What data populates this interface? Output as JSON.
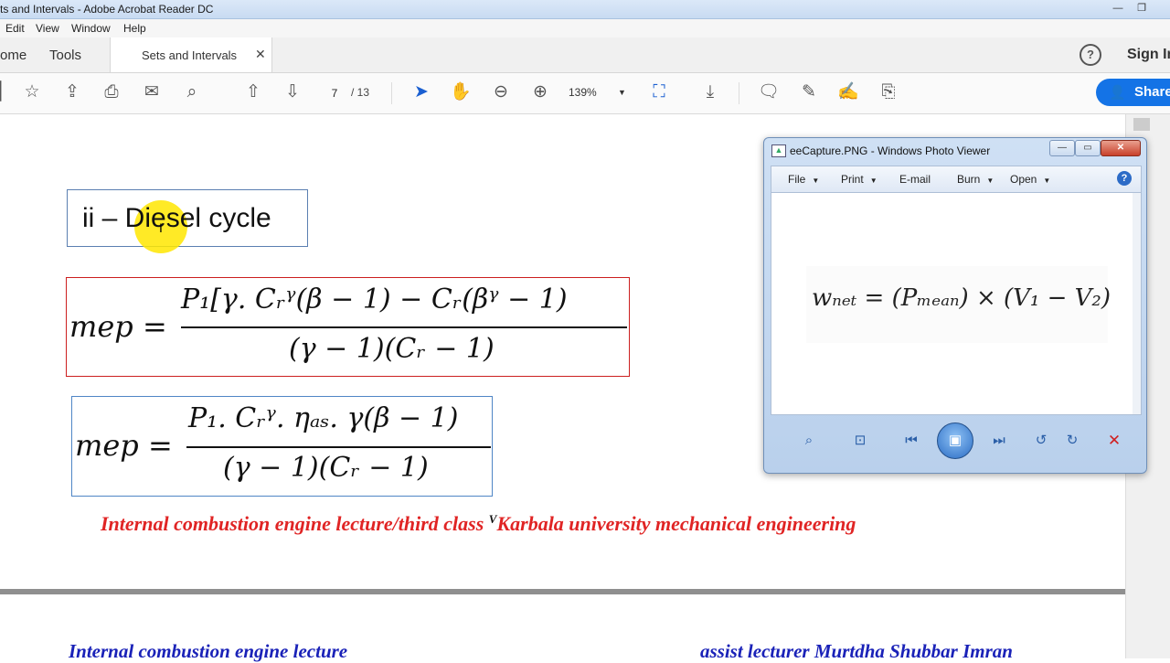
{
  "acrobat": {
    "title": "ts and Intervals - Adobe Acrobat Reader DC",
    "menu": [
      "Edit",
      "View",
      "Window",
      "Help"
    ],
    "tabs": {
      "home": "ome",
      "tools": "Tools",
      "document": "Sets and Intervals"
    },
    "help_label": "?",
    "sign_in": "Sign In",
    "page_current": "7",
    "page_total": "/ 13",
    "zoom": "139%",
    "share": "Share"
  },
  "document": {
    "heading": "ii – Diesel cycle",
    "equation1": {
      "lhs": "mep =",
      "numerator": "P₁[γ. Cᵣᵞ(β − 1) − Cᵣ(βᵞ − 1)",
      "denominator": "(γ − 1)(Cᵣ − 1)"
    },
    "equation2": {
      "lhs": "mep =",
      "numerator": "P₁. Cᵣᵞ. ηₐₛ. γ(β − 1)",
      "denominator": "(γ − 1)(Cᵣ − 1)"
    },
    "footer_red_left": "Internal combustion engine lecture/third class",
    "footer_red_mark": "V",
    "footer_red_right": "Karbala university mechanical engineering",
    "footer_blue_left": "Internal combustion engine lecture",
    "footer_blue_right": "assist lecturer Murtdha Shubbar Imran"
  },
  "photo_viewer": {
    "title": "eeCapture.PNG - Windows Photo Viewer",
    "menu": [
      "File",
      "Print",
      "E-mail",
      "Burn",
      "Open"
    ],
    "image_text": "wₙₑₜ = (Pₘₑₐₙ) × (V₁ − V₂)"
  },
  "colors": {
    "accent": "#1473e6",
    "equation1_border": "#cc1f1f",
    "equation2_border": "#4f86c6",
    "footer_red": "#e02424",
    "footer_blue": "#1a22b8",
    "highlight": "#ffe600"
  }
}
